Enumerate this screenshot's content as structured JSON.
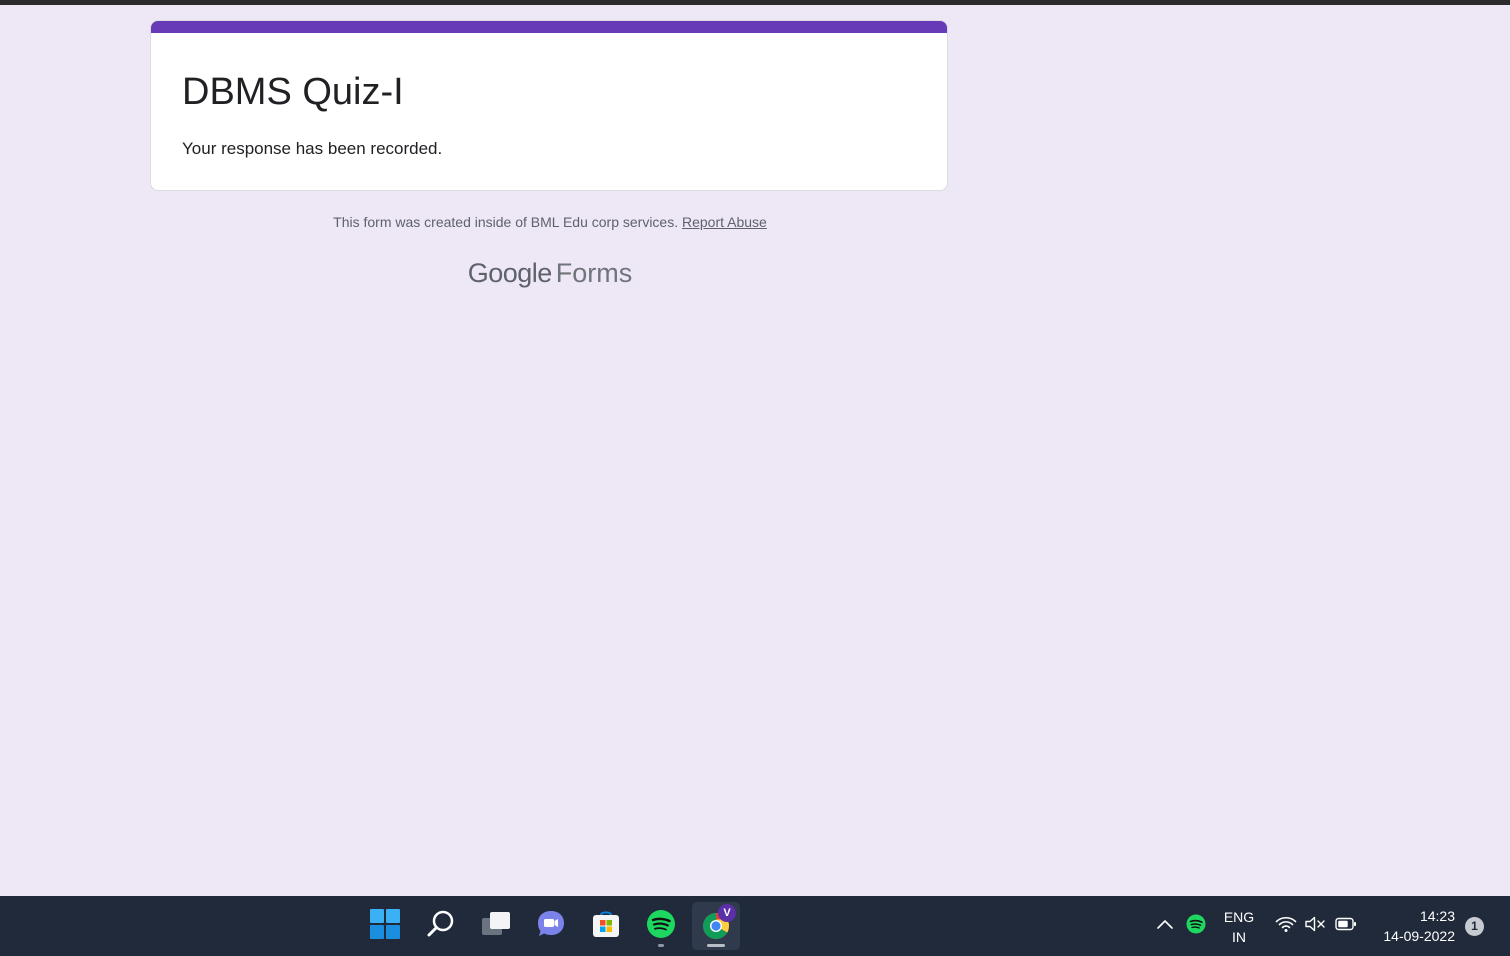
{
  "form": {
    "title": "DBMS Quiz-I",
    "confirmation": "Your response has been recorded.",
    "accent_color": "#673ab7"
  },
  "footer": {
    "note": "This form was created inside of BML Edu corp services.",
    "report_link": "Report Abuse",
    "logo_google": "Google",
    "logo_forms": "Forms"
  },
  "taskbar": {
    "apps": [
      {
        "name": "start",
        "icon": "windows-start-icon"
      },
      {
        "name": "search",
        "icon": "search-icon"
      },
      {
        "name": "task-view",
        "icon": "task-view-icon"
      },
      {
        "name": "teams-chat",
        "icon": "teams-chat-icon"
      },
      {
        "name": "microsoft-store",
        "icon": "store-icon"
      },
      {
        "name": "spotify",
        "icon": "spotify-icon",
        "running": true
      },
      {
        "name": "chrome",
        "icon": "chrome-icon",
        "running": true,
        "active": true,
        "profile_initial": "V"
      }
    ],
    "tray": {
      "language_line1": "ENG",
      "language_line2": "IN",
      "time": "14:23",
      "date": "14-09-2022",
      "notification_count": "1"
    }
  }
}
